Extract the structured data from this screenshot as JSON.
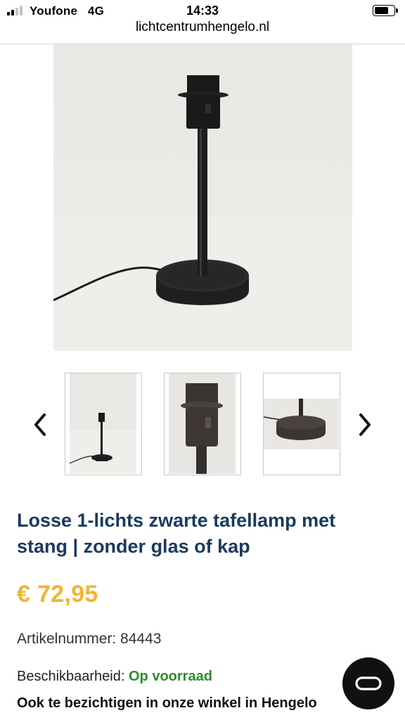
{
  "status_bar": {
    "carrier": "Youfone",
    "network": "4G",
    "time": "14:33",
    "signal_bars_active": 2,
    "signal_bars_total": 4
  },
  "browser": {
    "url": "lichtcentrumhengelo.nl"
  },
  "gallery": {
    "main_image_icon": "table-lamp-base-photo",
    "thumbnails": [
      {
        "icon": "lamp-full-view-photo"
      },
      {
        "icon": "lamp-socket-closeup-photo"
      },
      {
        "icon": "lamp-base-closeup-photo"
      }
    ],
    "prev_icon": "chevron-left-icon",
    "next_icon": "chevron-right-icon"
  },
  "product": {
    "title": "Losse 1-lichts zwarte tafellamp met stang | zonder glas of kap",
    "price": "€ 72,95",
    "sku_label": "Artikelnummer:",
    "sku_value": "84443",
    "availability_label": "Beschikbaarheid:",
    "availability_value": "Op voorraad",
    "showroom_text": "Ook te bezichtigen in onze winkel in Hengelo"
  },
  "colors": {
    "title": "#1a3a5c",
    "price": "#f3b431",
    "in_stock": "#2e8b2e",
    "chat_button": "#111111"
  },
  "chat": {
    "icon": "chat-loop-icon"
  }
}
